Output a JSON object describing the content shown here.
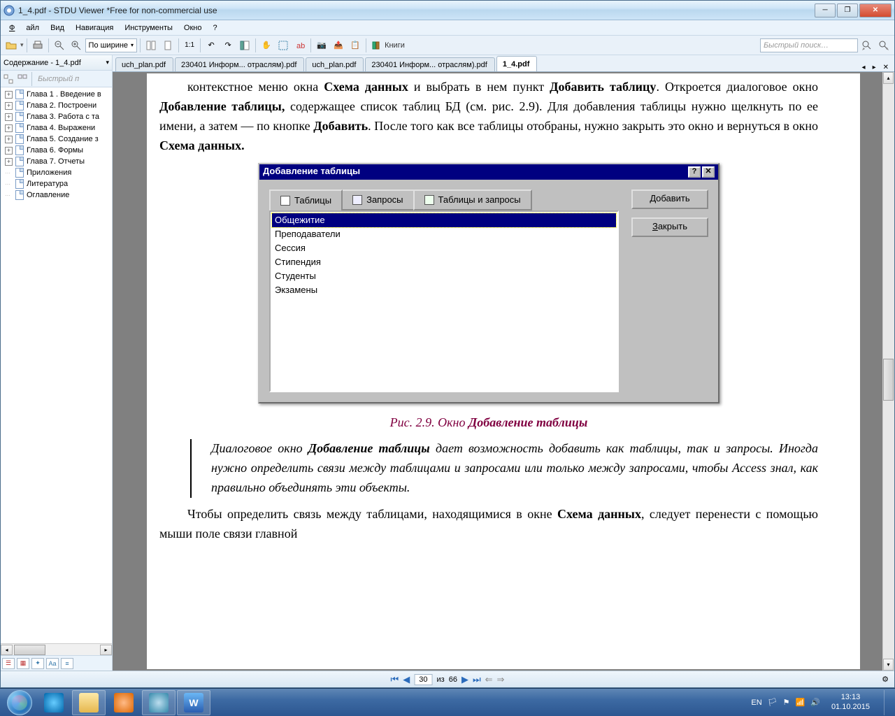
{
  "window": {
    "title": "1_4.pdf - STDU Viewer *Free for non-commercial use"
  },
  "menu": {
    "file": "Файл",
    "view": "Вид",
    "nav": "Навигация",
    "tools": "Инструменты",
    "window": "Окно",
    "help": "?"
  },
  "toolbar": {
    "zoom_mode": "По ширине",
    "ratio": "1:1",
    "books": "Книги",
    "search_placeholder": "Быстрый поиск…"
  },
  "sidebar": {
    "title": "Содержание - 1_4.pdf",
    "quick": "Быстрый п",
    "items": [
      {
        "label": "Глава 1 . Введение в",
        "expandable": true
      },
      {
        "label": "Глава 2. Построени",
        "expandable": true
      },
      {
        "label": "Глава 3. Работа с та",
        "expandable": true
      },
      {
        "label": "Глава 4. Выражени",
        "expandable": true
      },
      {
        "label": "Глава 5. Создание з",
        "expandable": true
      },
      {
        "label": "Глава 6. Формы",
        "expandable": true
      },
      {
        "label": "Глава 7. Отчеты",
        "expandable": true
      },
      {
        "label": "Приложения",
        "expandable": false
      },
      {
        "label": "Литература",
        "expandable": false
      },
      {
        "label": "Оглавление",
        "expandable": false
      }
    ]
  },
  "tabs": [
    {
      "label": "uch_plan.pdf",
      "active": false
    },
    {
      "label": "230401 Информ... отраслям).pdf",
      "active": false
    },
    {
      "label": "uch_plan.pdf",
      "active": false
    },
    {
      "label": "230401 Информ... отраслям).pdf",
      "active": false
    },
    {
      "label": "1_4.pdf",
      "active": true
    }
  ],
  "document": {
    "p1_pre": "контекстное меню окна ",
    "p1_b1": "Схема данных",
    "p1_mid1": " и выбрать в нем пункт ",
    "p1_b2": "Добавить таблицу",
    "p1_mid2": ". Откроется диалоговое окно ",
    "p1_b3": "Добавление таблицы,",
    "p1_mid3": " содержащее список таблиц БД (см. рис. 2.9). Для добавления таблицы нужно щелкнуть по ее имени, а затем — по кнопке ",
    "p1_b4": "Добавить",
    "p1_mid4": ". После того как все таблицы отобраны, нужно закрыть это окно и вернуться в окно ",
    "p1_b5": "Схема данных.",
    "dialog": {
      "title": "Добавление таблицы",
      "tab_tables": "Таблицы",
      "tab_queries": "Запросы",
      "tab_both": "Таблицы и запросы",
      "list": [
        "Общежитие",
        "Преподаватели",
        "Сессия",
        "Стипендия",
        "Студенты",
        "Экзамены"
      ],
      "btn_add": "Добавить",
      "btn_close": "Закрыть"
    },
    "caption_pre": "Рис. 2.9. Окно ",
    "caption_bold": "Добавление таблицы",
    "note_pre": "Диалоговое окно ",
    "note_bold": "Добавление таблицы",
    "note_rest": " дает возможность добавить как таблицы, так и запросы. Иногда нужно определить связи между таблицами и запросами или только между запросами, чтобы Access знал, как правильно объединять эти объекты.",
    "p2_pre": "Чтобы определить связь между таблицами, находящимися в окне ",
    "p2_b1": "Схема данных",
    "p2_rest": ", следует перенести с помощью мыши поле связи главной"
  },
  "pager": {
    "page": "30",
    "of_label": "из",
    "total": "66"
  },
  "tray": {
    "lang": "EN",
    "time": "13:13",
    "date": "01.10.2015"
  }
}
